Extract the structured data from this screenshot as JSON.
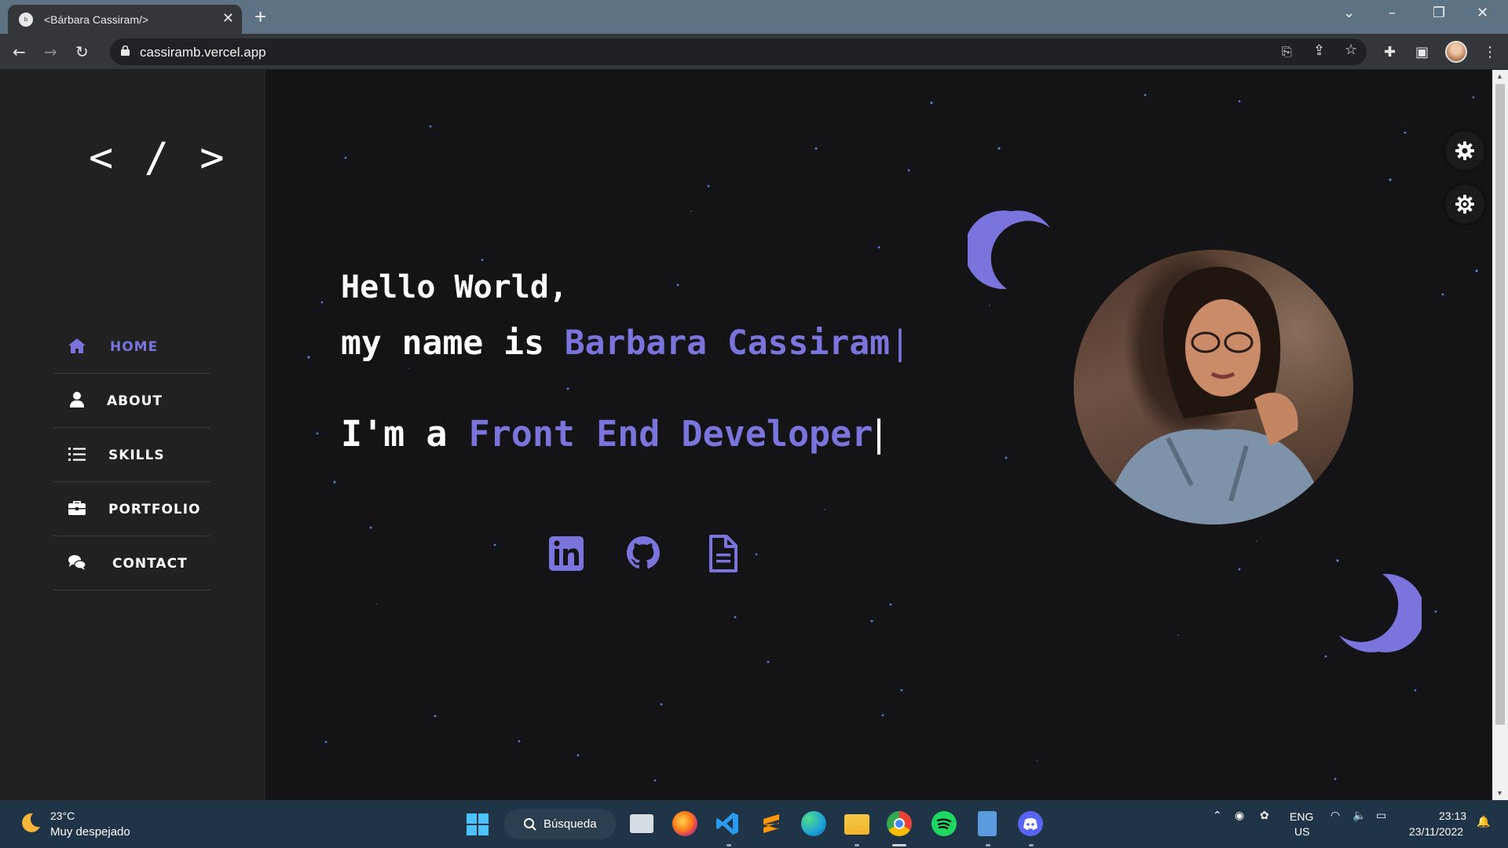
{
  "browser": {
    "tab_title": "<Bárbara Cassiram/>",
    "tab_favicon": "b",
    "url": "cassiramb.vercel.app"
  },
  "sidebar": {
    "logo": "< / >",
    "items": [
      {
        "label": "HOME",
        "icon": "home-icon",
        "active": true
      },
      {
        "label": "ABOUT",
        "icon": "user-icon",
        "active": false
      },
      {
        "label": "SKILLS",
        "icon": "list-icon",
        "active": false
      },
      {
        "label": "PORTFOLIO",
        "icon": "briefcase-icon",
        "active": false
      },
      {
        "label": "CONTACT",
        "icon": "comments-icon",
        "active": false
      }
    ]
  },
  "hero": {
    "line1": "Hello World,",
    "line2_prefix": "my name is ",
    "line2_name": "Barbara Cassiram",
    "line2_caret": "|",
    "line3_prefix": "I'm a ",
    "line3_role": "Front End Developer"
  },
  "colors": {
    "accent": "#7b74dc",
    "background": "#141316",
    "sidebar": "#212121"
  },
  "taskbar": {
    "temperature": "23°C",
    "condition": "Muy despejado",
    "search_label": "Búsqueda",
    "lang_line1": "ENG",
    "lang_line2": "US",
    "time": "23:13",
    "date": "23/11/2022"
  }
}
